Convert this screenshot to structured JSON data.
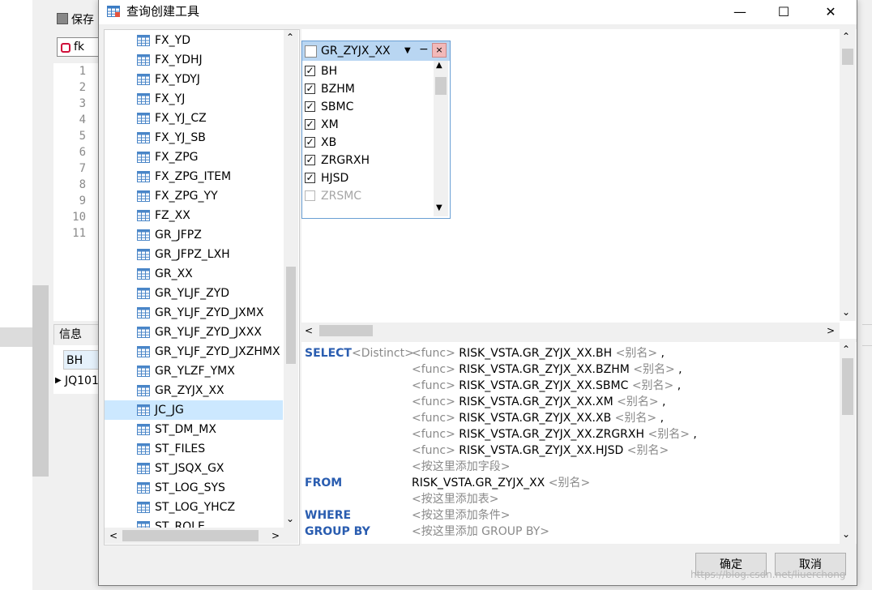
{
  "background_app": {
    "save_label": "保存",
    "connection_label": "fk",
    "line_numbers": [
      "1",
      "2",
      "3",
      "4",
      "5",
      "6",
      "7",
      "8",
      "9",
      "10",
      "11"
    ],
    "info_tab": "信息",
    "grid_header": "BH",
    "grid_row_value": "JQ101"
  },
  "dialog": {
    "title": "查询创建工具",
    "window_controls": {
      "minimize": "—",
      "maximize": "☐",
      "close": "✕"
    },
    "tree": {
      "items": [
        {
          "label": "FX_YD"
        },
        {
          "label": "FX_YDHJ"
        },
        {
          "label": "FX_YDYJ"
        },
        {
          "label": "FX_YJ"
        },
        {
          "label": "FX_YJ_CZ"
        },
        {
          "label": "FX_YJ_SB"
        },
        {
          "label": "FX_ZPG"
        },
        {
          "label": "FX_ZPG_ITEM"
        },
        {
          "label": "FX_ZPG_YY"
        },
        {
          "label": "FZ_XX"
        },
        {
          "label": "GR_JFPZ"
        },
        {
          "label": "GR_JFPZ_LXH"
        },
        {
          "label": "GR_XX"
        },
        {
          "label": "GR_YLJF_ZYD"
        },
        {
          "label": "GR_YLJF_ZYD_JXMX"
        },
        {
          "label": "GR_YLJF_ZYD_JXXX"
        },
        {
          "label": "GR_YLJF_ZYD_JXZHMX"
        },
        {
          "label": "GR_YLZF_YMX"
        },
        {
          "label": "GR_ZYJX_XX"
        },
        {
          "label": "JC_JG"
        },
        {
          "label": "ST_DM_MX"
        },
        {
          "label": "ST_FILES"
        },
        {
          "label": "ST_JSQX_GX"
        },
        {
          "label": "ST_LOG_SYS"
        },
        {
          "label": "ST_LOG_YHCZ"
        },
        {
          "label": "ST_ROLE"
        }
      ],
      "selected_index": 19
    },
    "table_box": {
      "title": "GR_ZYJX_XX",
      "close": "×",
      "minimize": "−",
      "columns": [
        {
          "name": "BH",
          "checked": true
        },
        {
          "name": "BZHM",
          "checked": true
        },
        {
          "name": "SBMC",
          "checked": true
        },
        {
          "name": "XM",
          "checked": true
        },
        {
          "name": "XB",
          "checked": true
        },
        {
          "name": "ZRGRXH",
          "checked": true
        },
        {
          "name": "HJSD",
          "checked": true
        },
        {
          "name": "ZRSMC",
          "checked": false
        }
      ]
    },
    "sql": {
      "select_kw": "SELECT",
      "distinct": "<Distinct>",
      "func": "<func>",
      "alias": "<别名>",
      "fields": [
        "RISK_VSTA.GR_ZYJX_XX.BH",
        "RISK_VSTA.GR_ZYJX_XX.BZHM",
        "RISK_VSTA.GR_ZYJX_XX.SBMC",
        "RISK_VSTA.GR_ZYJX_XX.XM",
        "RISK_VSTA.GR_ZYJX_XX.XB",
        "RISK_VSTA.GR_ZYJX_XX.ZRGRXH",
        "RISK_VSTA.GR_ZYJX_XX.HJSD"
      ],
      "add_field": "<按这里添加字段>",
      "from_kw": "FROM",
      "from_table": "RISK_VSTA.GR_ZYJX_XX",
      "add_table": "<按这里添加表>",
      "where_kw": "WHERE",
      "add_condition": "<按这里添加条件>",
      "groupby_kw": "GROUP BY",
      "add_groupby": "<按这里添加 GROUP BY>"
    },
    "buttons": {
      "ok": "确定",
      "cancel": "取消"
    },
    "watermark": "https://blog.csdn.net/liuerchong"
  },
  "colors": {
    "selection": "#cce8ff",
    "keyword": "#2a5db0",
    "placeholder": "#8a8a8a",
    "table_header": "#b9d6f2"
  }
}
